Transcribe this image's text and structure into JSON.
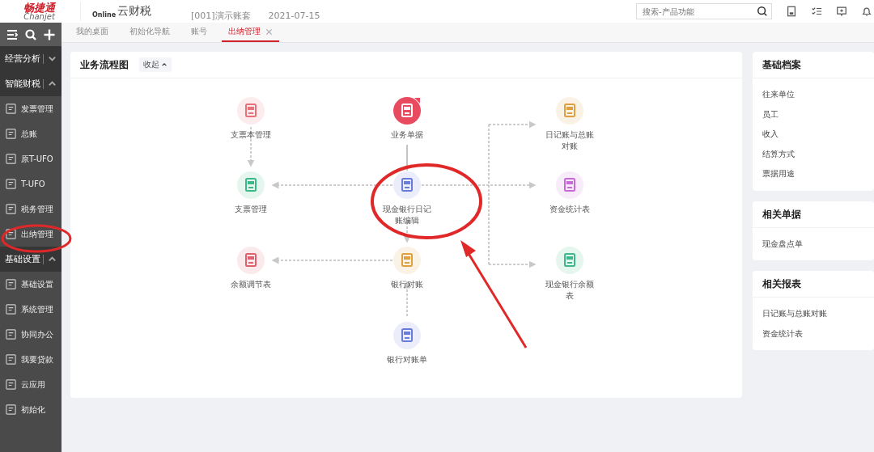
{
  "header": {
    "logo": "畅捷通",
    "logo_subtitle": "Chanjet",
    "product": "云财税",
    "product_badge": "Online",
    "account": "[001]演示账套",
    "date": "2021-07-15",
    "search": {
      "placeholder": "搜索-产品功能"
    }
  },
  "tabs": [
    {
      "label": "我的桌面",
      "selected": false
    },
    {
      "label": "初始化导航",
      "selected": false
    },
    {
      "label": "账号",
      "selected": false
    },
    {
      "label": "出纳管理",
      "selected": true
    }
  ],
  "sidebar": {
    "sections": [
      {
        "label": "经营分析",
        "expanded": false
      },
      {
        "label": "智能财税",
        "expanded": true,
        "children": [
          {
            "label": "发票管理",
            "selected": false
          },
          {
            "label": "总账",
            "selected": false
          },
          {
            "label": "原T-UFO",
            "selected": false
          },
          {
            "label": "T-UFO",
            "selected": false
          },
          {
            "label": "税务管理",
            "selected": false
          },
          {
            "label": "出纳管理",
            "selected": false
          }
        ]
      },
      {
        "label": "基础设置",
        "expanded": true,
        "children": [
          {
            "label": "基础设置",
            "selected": false
          },
          {
            "label": "系统管理",
            "selected": false
          },
          {
            "label": "协同办公",
            "selected": false
          },
          {
            "label": "我要贷款",
            "selected": false
          },
          {
            "label": "云应用",
            "selected": false
          },
          {
            "label": "初始化",
            "selected": false
          }
        ]
      }
    ]
  },
  "flow": {
    "title": "业务流程图",
    "collapse_button": "收起",
    "nodes": [
      {
        "label": "支票本管理",
        "color": "#e8707a",
        "highlighted": false
      },
      {
        "label": "业务单据",
        "color": "#e84a5f",
        "highlighted": true
      },
      {
        "label": "日记账与总账对账",
        "color": "#e0a040",
        "highlighted": false
      },
      {
        "label": "支票管理",
        "color": "#3cb88a",
        "highlighted": false
      },
      {
        "label": "现金银行日记账编辑",
        "color": "#6a7bd8",
        "highlighted": false
      },
      {
        "label": "资金统计表",
        "color": "#c86ad8",
        "highlighted": false
      },
      {
        "label": "余额调节表",
        "color": "#e06070",
        "highlighted": false
      },
      {
        "label": "银行对账",
        "color": "#e0a040",
        "highlighted": false
      },
      {
        "label": "现金银行余额表",
        "color": "#3cb88a",
        "highlighted": false
      },
      {
        "label": "银行对账单",
        "color": "#6a7bd8",
        "highlighted": false
      }
    ]
  },
  "side_panels": [
    {
      "title": "基础档案",
      "items": [
        "往来单位",
        "员工",
        "收入",
        "结算方式",
        "票据用途"
      ]
    },
    {
      "title": "相关单据",
      "items": [
        "现金盘点单"
      ]
    },
    {
      "title": "相关报表",
      "items": [
        "日记账与总账对账",
        "资金统计表"
      ]
    }
  ]
}
